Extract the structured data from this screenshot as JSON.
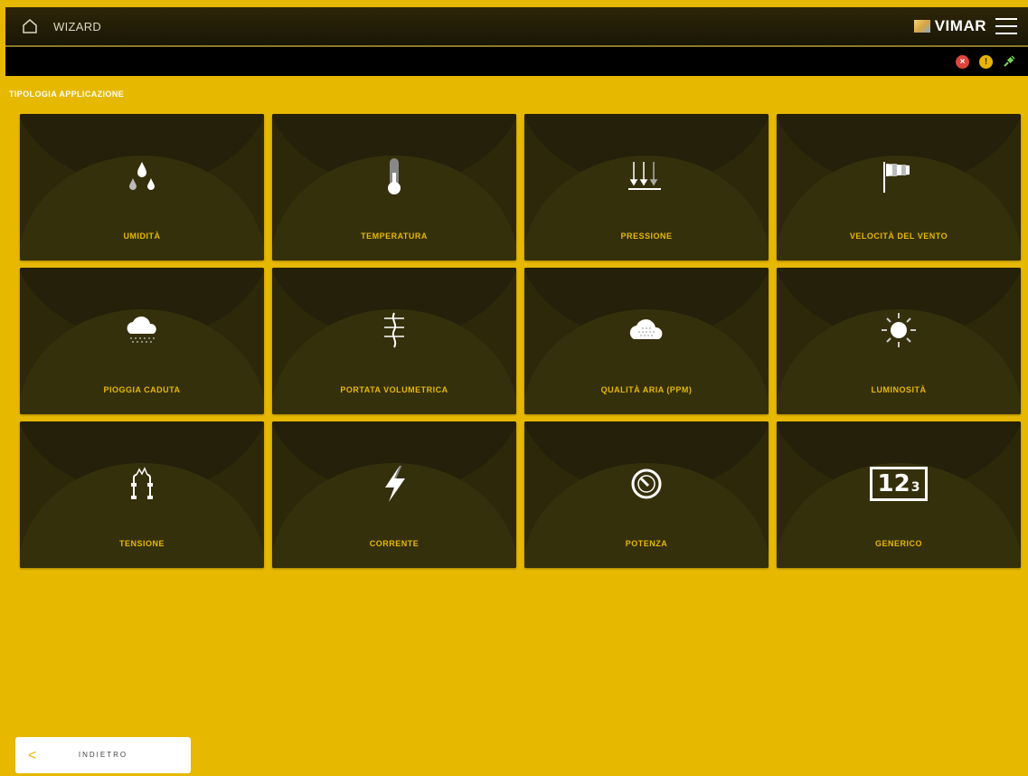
{
  "header": {
    "title": "WIZARD",
    "brand": "VIMAR"
  },
  "status": {
    "error_symbol": "×",
    "warning_symbol": "!"
  },
  "section_title": "TIPOLOGIA APPLICAZIONE",
  "tiles": [
    {
      "label": "UMIDITÀ",
      "icon": "humidity-icon"
    },
    {
      "label": "TEMPERATURA",
      "icon": "thermometer-icon"
    },
    {
      "label": "PRESSIONE",
      "icon": "pressure-icon"
    },
    {
      "label": "VELOCITÀ DEL VENTO",
      "icon": "windsock-icon"
    },
    {
      "label": "PIOGGIA CADUTA",
      "icon": "rain-cloud-icon"
    },
    {
      "label": "PORTATA VOLUMETRICA",
      "icon": "flow-icon"
    },
    {
      "label": "QUALITÀ ARIA (PPM)",
      "icon": "air-quality-icon"
    },
    {
      "label": "LUMINOSITÀ",
      "icon": "sun-icon"
    },
    {
      "label": "TENSIONE",
      "icon": "voltage-icon"
    },
    {
      "label": "CORRENTE",
      "icon": "lightning-icon"
    },
    {
      "label": "POTENZA",
      "icon": "gauge-icon"
    },
    {
      "label": "GENERICO",
      "icon": "generic-numbers-icon",
      "icon_text": "12",
      "icon_sub": "3"
    }
  ],
  "footer": {
    "back_label": "INDIETRO",
    "back_chevron": "<"
  },
  "colors": {
    "accent": "#e6b800",
    "tile_bg": "#2d2809",
    "topbar": "#1a1606"
  }
}
